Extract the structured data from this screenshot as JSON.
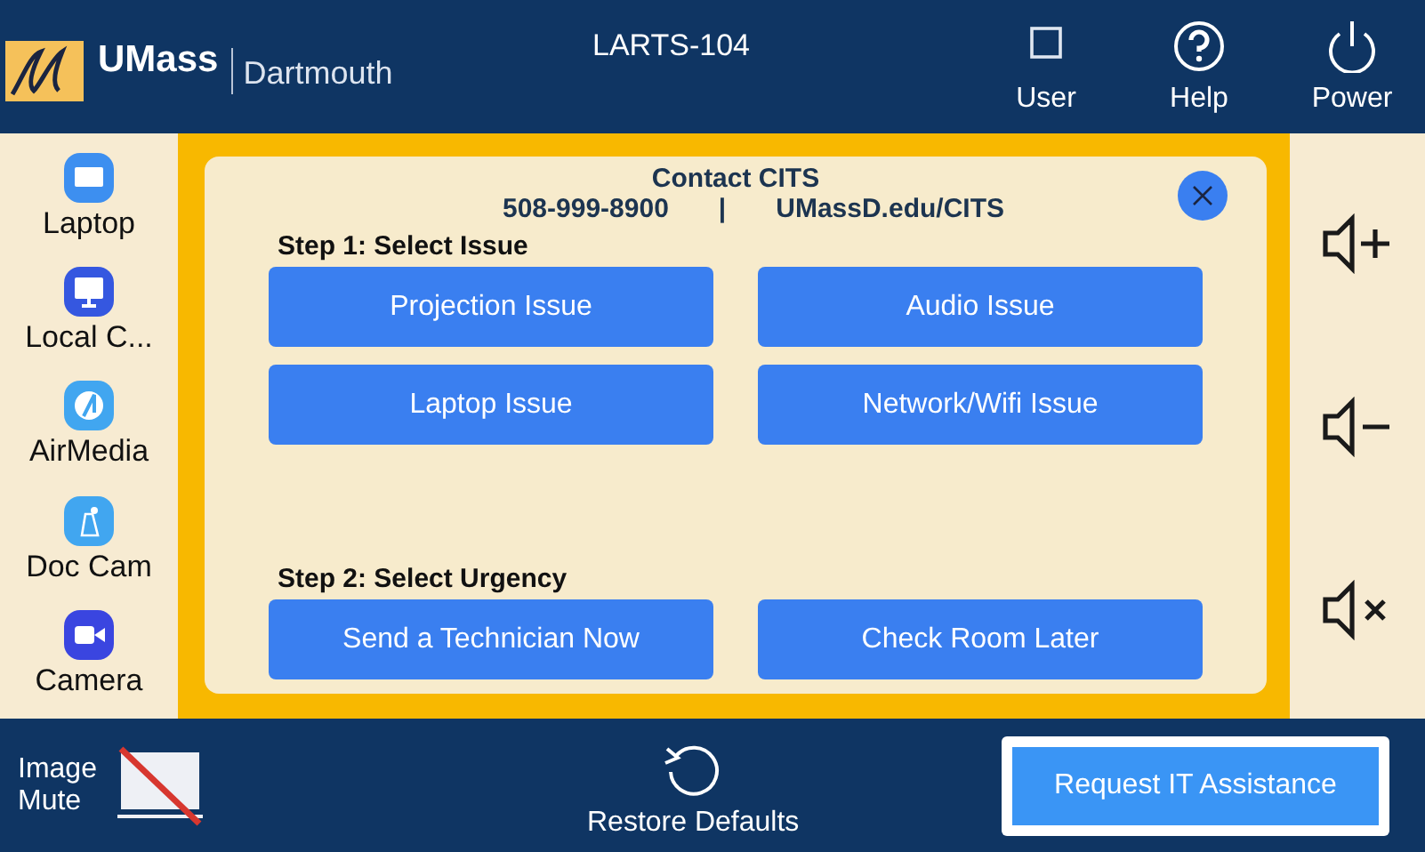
{
  "header": {
    "logo": {
      "name": "UMass",
      "campus": "Dartmouth"
    },
    "room": "LARTS-104",
    "buttons": [
      {
        "label": "User"
      },
      {
        "label": "Help"
      },
      {
        "label": "Power"
      }
    ]
  },
  "sources": [
    {
      "label": "Laptop",
      "color": "#3d8ff0"
    },
    {
      "label": "Local C...",
      "color": "#3557e0"
    },
    {
      "label": "AirMedia",
      "color": "#41a6f0"
    },
    {
      "label": "Doc Cam",
      "color": "#41a6f0"
    },
    {
      "label": "Camera",
      "color": "#3a45e0"
    }
  ],
  "dialog": {
    "title": "Contact CITS",
    "phone": "508-999-8900",
    "separator": "|",
    "website": "UMassD.edu/CITS",
    "sections": [
      {
        "heading": "Step 1: Select Issue",
        "options": [
          "Projection Issue",
          "Audio Issue",
          "Laptop Issue",
          "Network/Wifi Issue"
        ]
      },
      {
        "heading": "Step 2: Select Urgency",
        "options": [
          "Send a Technician Now",
          "Check Room Later"
        ]
      }
    ]
  },
  "footer": {
    "image_mute": "Image Mute",
    "restore": "Restore Defaults",
    "request": "Request IT Assistance"
  }
}
